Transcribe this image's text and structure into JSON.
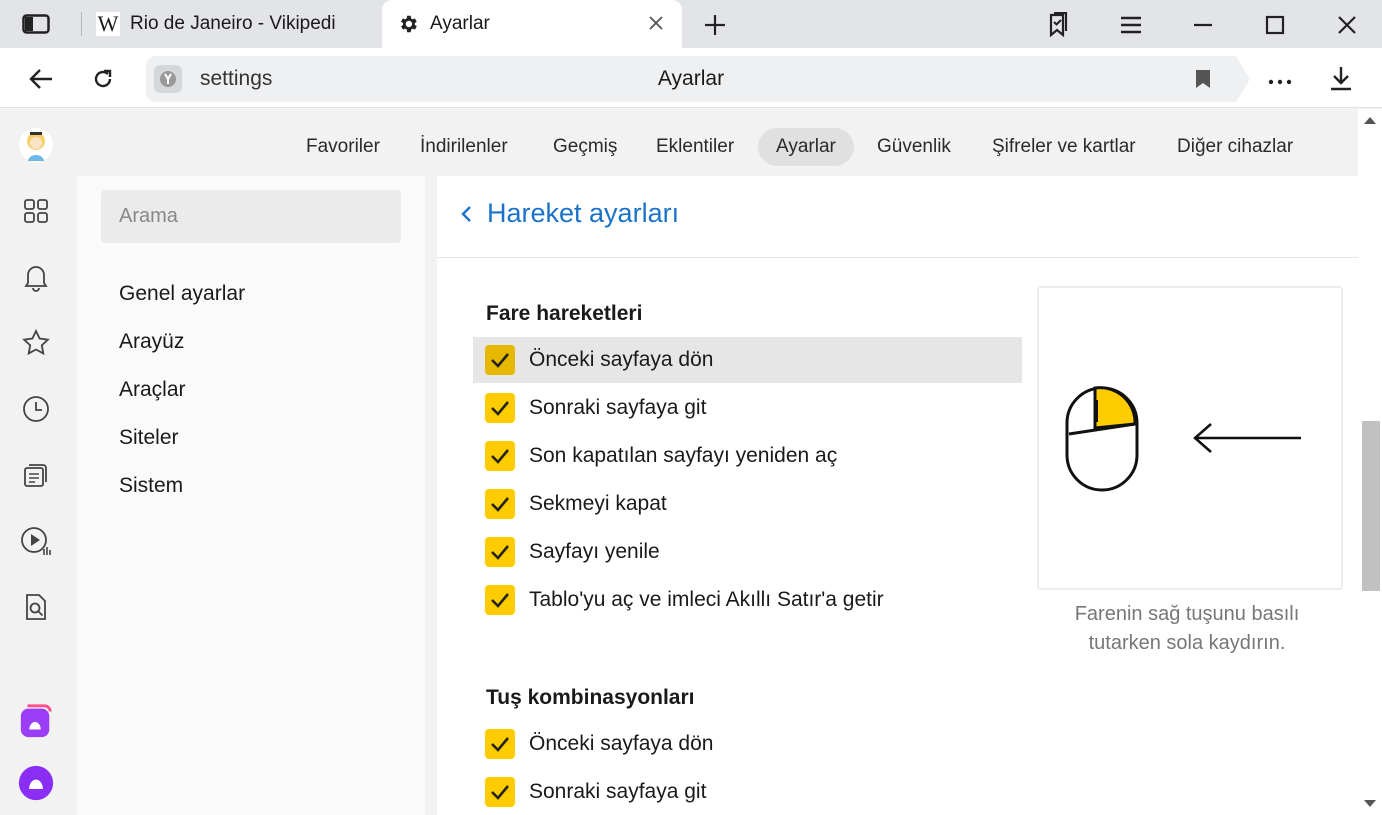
{
  "tabs": [
    {
      "label": "Rio de Janeiro - Vikipedi",
      "favicon": "wikipedia-icon"
    },
    {
      "label": "Ayarlar",
      "favicon": "gear-icon"
    }
  ],
  "addressbar": {
    "url": "settings",
    "title": "Ayarlar"
  },
  "nav_tabs": [
    "Favoriler",
    "İndirilenler",
    "Geçmiş",
    "Eklentiler",
    "Ayarlar",
    "Güvenlik",
    "Şifreler ve kartlar",
    "Diğer cihazlar"
  ],
  "active_nav_tab": "Ayarlar",
  "search": {
    "placeholder": "Arama"
  },
  "settings_menu": [
    "Genel ayarlar",
    "Arayüz",
    "Araçlar",
    "Siteler",
    "Sistem"
  ],
  "page": {
    "back_title": "Hareket ayarları",
    "mouse_section_title": "Fare hareketleri",
    "mouse_gestures": [
      {
        "label": "Önceki sayfaya dön",
        "checked": true
      },
      {
        "label": "Sonraki sayfaya git",
        "checked": true
      },
      {
        "label": "Son kapatılan sayfayı yeniden aç",
        "checked": true
      },
      {
        "label": "Sekmeyi kapat",
        "checked": true
      },
      {
        "label": "Sayfayı yenile",
        "checked": true
      },
      {
        "label": "Tablo'yu aç ve imleci Akıllı Satır'a getir",
        "checked": true
      }
    ],
    "keys_section_title": "Tuş kombinasyonları",
    "key_combos": [
      {
        "label": "Önceki sayfaya dön",
        "checked": true
      },
      {
        "label": "Sonraki sayfaya git",
        "checked": true
      }
    ],
    "illustration_caption_line1": "Farenin sağ tuşunu basılı",
    "illustration_caption_line2": "tutarken sola kaydırın."
  },
  "colors": {
    "accent": "#ffcc00",
    "link": "#1a73c9"
  }
}
